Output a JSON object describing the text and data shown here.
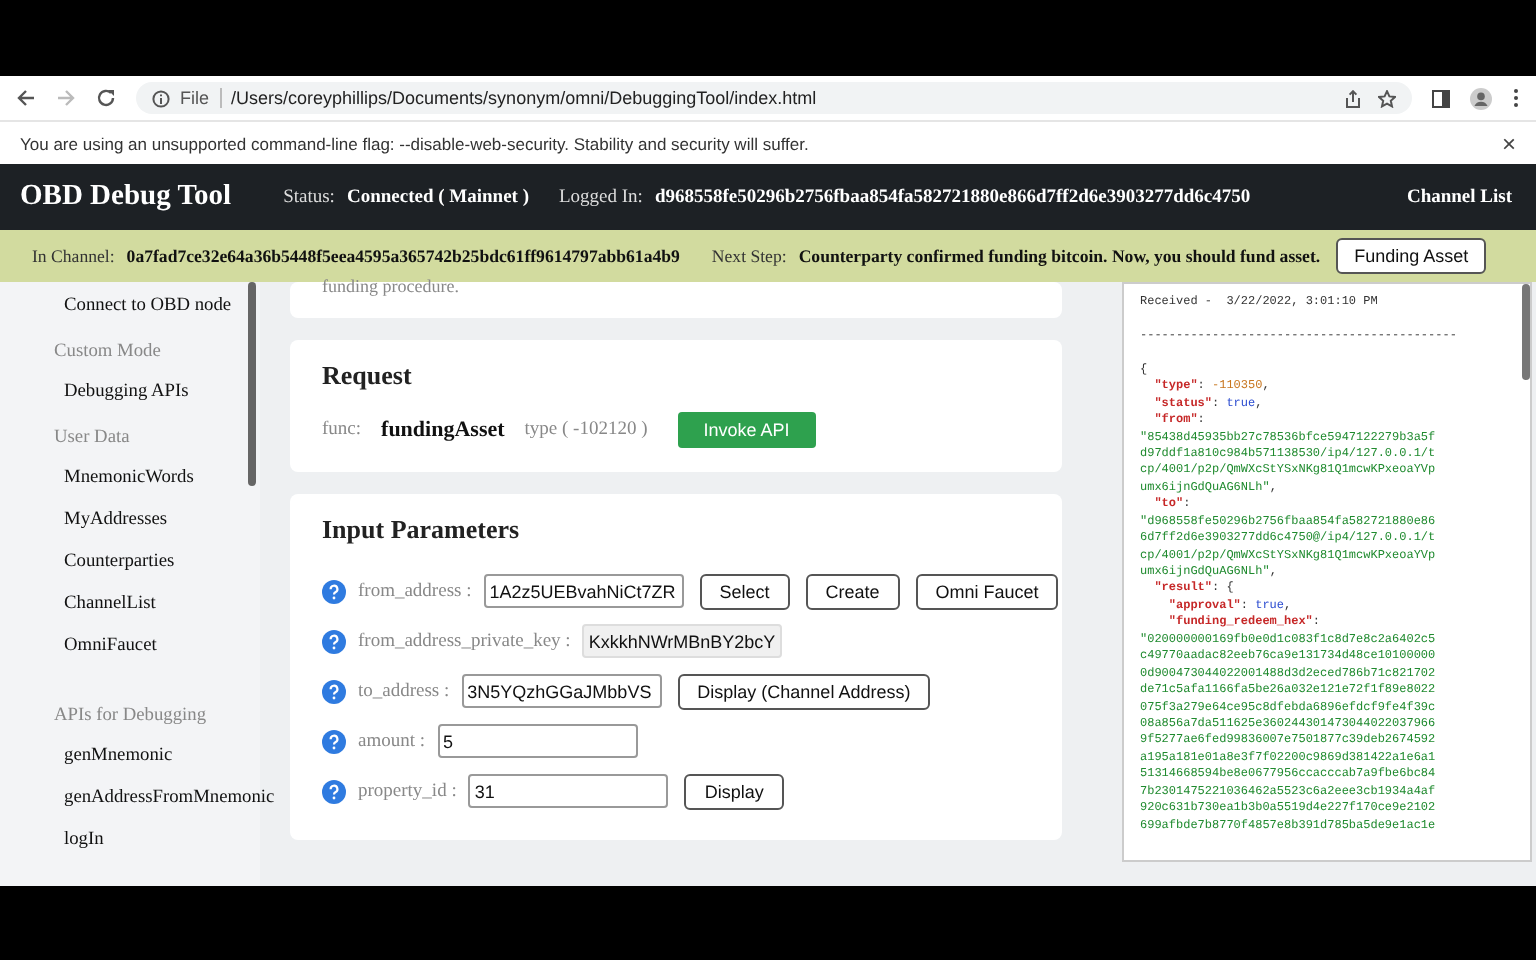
{
  "browser": {
    "scheme": "File",
    "url": "/Users/coreyphillips/Documents/synonym/omni/DebuggingTool/index.html"
  },
  "warning": {
    "text": "You are using an unsupported command-line flag: --disable-web-security. Stability and security will suffer.",
    "close": "×"
  },
  "header": {
    "title": "OBD Debug Tool",
    "status_label": "Status:",
    "status": "Connected ( Mainnet )",
    "logged_label": "Logged In:",
    "logged": "d968558fe50296b2756fbaa854fa582721880e866d7ff2d6e3903277dd6c4750",
    "link": "Channel List"
  },
  "channel_bar": {
    "channel_label": "In Channel:",
    "channel": "0a7fad7ce32e64a36b5448f5eea4595a365742b25bdc61ff9614797abb61a4b9",
    "step_label": "Next Step:",
    "step": "Counterparty confirmed funding bitcoin. Now, you should fund asset.",
    "button": "Funding Asset"
  },
  "sidebar": [
    {
      "items": [
        "Connect to OBD node"
      ]
    },
    {
      "heading": "Custom Mode",
      "items": [
        "Debugging APIs"
      ]
    },
    {
      "heading": "User Data",
      "items": [
        "MnemonicWords",
        "MyAddresses",
        "Counterparties",
        "ChannelList",
        "OmniFaucet"
      ]
    },
    {
      "heading": "APIs for Debugging",
      "items": [
        "genMnemonic",
        "genAddressFromMnemonic",
        "logIn"
      ]
    }
  ],
  "notice": {
    "text": "funding procedure."
  },
  "request": {
    "title": "Request",
    "func_label": "func:",
    "func": "fundingAsset",
    "type": "type ( -102120 )",
    "button": "Invoke API"
  },
  "inputs": {
    "title": "Input Parameters",
    "fields": [
      {
        "label": "from_address :",
        "value": "1A2z5UEBvahNiCt7ZR",
        "readonly": false,
        "buttons": [
          "Select",
          "Create",
          "Omni Faucet"
        ]
      },
      {
        "label": "from_address_private_key :",
        "value": "KxkkhNWrMBnBY2bcY",
        "readonly": true
      },
      {
        "label": "to_address :",
        "value": "3N5YQzhGGaJMbbVS",
        "readonly": false,
        "buttons": [
          "Display (Channel Address)"
        ]
      },
      {
        "label": "amount :",
        "value": "5",
        "readonly": false
      },
      {
        "label": "property_id :",
        "value": "31",
        "readonly": false,
        "buttons": [
          "Display"
        ]
      }
    ]
  },
  "log": {
    "lines": [
      {
        "kind": "top",
        "segments": [
          {
            "kind": "text",
            "text": "Received -  3/22/2022, 3:01:10 PM"
          }
        ]
      },
      {
        "kind": "blank"
      },
      {
        "kind": "top",
        "segments": [
          {
            "kind": "text",
            "text": "--------------------------------------------"
          }
        ]
      },
      {
        "kind": "blank"
      },
      {
        "kind": "top",
        "segments": [
          {
            "kind": "punct",
            "text": "{"
          }
        ]
      },
      {
        "kind": "nested",
        "segments": [
          {
            "kind": "key",
            "text": "\"type\""
          },
          {
            "kind": "punct",
            "text": ": "
          },
          {
            "kind": "number",
            "text": "-110350"
          },
          {
            "kind": "punct",
            "text": ","
          }
        ]
      },
      {
        "kind": "nested",
        "segments": [
          {
            "kind": "key",
            "text": "\"status\""
          },
          {
            "kind": "punct",
            "text": ": "
          },
          {
            "kind": "bool",
            "text": "true"
          },
          {
            "kind": "punct",
            "text": ","
          }
        ]
      },
      {
        "kind": "nested",
        "segments": [
          {
            "kind": "key",
            "text": "\"from\""
          },
          {
            "kind": "punct",
            "text": ":"
          }
        ]
      },
      {
        "kind": "top",
        "segments": [
          {
            "kind": "string",
            "text": "\"85438d45935bb27c78536bfce5947122279b3a5f"
          }
        ]
      },
      {
        "kind": "top",
        "segments": [
          {
            "kind": "string",
            "text": "d97ddf1a810c984b571138530/ip4/127.0.0.1/t"
          }
        ]
      },
      {
        "kind": "top",
        "segments": [
          {
            "kind": "string",
            "text": "cp/4001/p2p/QmWXcStYSxNKg81Q1mcwKPxeoaYVp"
          }
        ]
      },
      {
        "kind": "top",
        "segments": [
          {
            "kind": "string",
            "text": "umx6ijnGdQuAG6NLh\""
          },
          {
            "kind": "punct",
            "text": ","
          }
        ]
      },
      {
        "kind": "nested",
        "segments": [
          {
            "kind": "key",
            "text": "\"to\""
          },
          {
            "kind": "punct",
            "text": ":"
          }
        ]
      },
      {
        "kind": "top",
        "segments": [
          {
            "kind": "string",
            "text": "\"d968558fe50296b2756fbaa854fa582721880e86"
          }
        ]
      },
      {
        "kind": "top",
        "segments": [
          {
            "kind": "string",
            "text": "6d7ff2d6e3903277dd6c4750@/ip4/127.0.0.1/t"
          }
        ]
      },
      {
        "kind": "top",
        "segments": [
          {
            "kind": "string",
            "text": "cp/4001/p2p/QmWXcStYSxNKg81Q1mcwKPxeoaYVp"
          }
        ]
      },
      {
        "kind": "top",
        "segments": [
          {
            "kind": "string",
            "text": "umx6ijnGdQuAG6NLh\""
          },
          {
            "kind": "punct",
            "text": ","
          }
        ]
      },
      {
        "kind": "nested",
        "segments": [
          {
            "kind": "key",
            "text": "\"result\""
          },
          {
            "kind": "punct",
            "text": ": {"
          }
        ]
      },
      {
        "kind": "nested2",
        "segments": [
          {
            "kind": "key",
            "text": "\"approval\""
          },
          {
            "kind": "punct",
            "text": ": "
          },
          {
            "kind": "bool",
            "text": "true"
          },
          {
            "kind": "punct",
            "text": ","
          }
        ]
      },
      {
        "kind": "nested2",
        "segments": [
          {
            "kind": "key",
            "text": "\"funding_redeem_hex\""
          },
          {
            "kind": "punct",
            "text": ":"
          }
        ]
      },
      {
        "kind": "top",
        "segments": [
          {
            "kind": "string",
            "text": "\"020000000169fb0e0d1c083f1c8d7e8c2a6402c5"
          }
        ]
      },
      {
        "kind": "top",
        "segments": [
          {
            "kind": "string",
            "text": "c49770aadac82eeb76ca9e131734d48ce10100000"
          }
        ]
      },
      {
        "kind": "top",
        "segments": [
          {
            "kind": "string",
            "text": "0d900473044022001488d3d2eced786b71c821702"
          }
        ]
      },
      {
        "kind": "top",
        "segments": [
          {
            "kind": "string",
            "text": "de71c5afa1166fa5be26a032e121e72f1f89e8022"
          }
        ]
      },
      {
        "kind": "top",
        "segments": [
          {
            "kind": "string",
            "text": "075f3a279e64ce95c8dfebda6896efdcf9fe4f39c"
          }
        ]
      },
      {
        "kind": "top",
        "segments": [
          {
            "kind": "string",
            "text": "08a856a7da511625e360244301473044022037966"
          }
        ]
      },
      {
        "kind": "top",
        "segments": [
          {
            "kind": "string",
            "text": "9f5277ae6fed99836007e7501877c39deb2674592"
          }
        ]
      },
      {
        "kind": "top",
        "segments": [
          {
            "kind": "string",
            "text": "a195a181e01a8e3f7f02200c9869d381422a1e6a1"
          }
        ]
      },
      {
        "kind": "top",
        "segments": [
          {
            "kind": "string",
            "text": "51314668594be8e0677956ccacccab7a9fbe6bc84"
          }
        ]
      },
      {
        "kind": "top",
        "segments": [
          {
            "kind": "string",
            "text": "7b2301475221036462a5523c6a2eee3cb1934a4af"
          }
        ]
      },
      {
        "kind": "top",
        "segments": [
          {
            "kind": "string",
            "text": "920c631b730ea1b3b0a5519d4e227f170ce9e2102"
          }
        ]
      },
      {
        "kind": "top",
        "segments": [
          {
            "kind": "string",
            "text": "699afbde7b8770f4857e8b391d785ba5de9e1ac1e"
          }
        ]
      }
    ]
  }
}
